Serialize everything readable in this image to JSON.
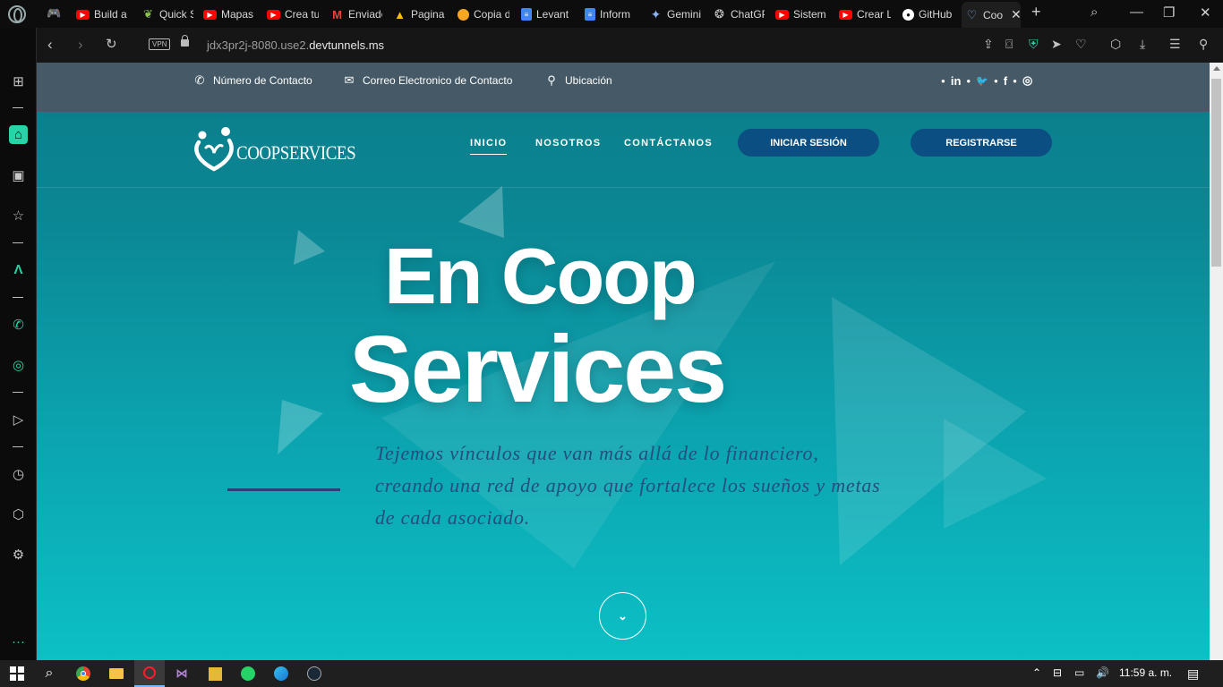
{
  "browser": {
    "tabs": [
      {
        "label": "Build a",
        "icon": "youtube-icon",
        "color": "#ff0000"
      },
      {
        "label": "Quick S",
        "icon": "leaf-icon",
        "color": "#8bc34a"
      },
      {
        "label": "Mapas",
        "icon": "youtube-icon",
        "color": "#ff0000"
      },
      {
        "label": "Crea tu",
        "icon": "youtube-icon",
        "color": "#ff0000"
      },
      {
        "label": "Enviado",
        "icon": "gmail-icon",
        "color": "#ea4335"
      },
      {
        "label": "Pagina",
        "icon": "drive-icon",
        "color": "#fbbc04"
      },
      {
        "label": "Copia d",
        "icon": "circle-icon",
        "color": "#f5a623"
      },
      {
        "label": "Levant",
        "icon": "docs-icon",
        "color": "#4285f4"
      },
      {
        "label": "Inform",
        "icon": "docs-icon",
        "color": "#4285f4"
      },
      {
        "label": "Gemini",
        "icon": "gemini-icon",
        "color": "#8ab4f8"
      },
      {
        "label": "ChatGP",
        "icon": "openai-icon",
        "color": "#cccccc"
      },
      {
        "label": "Sistem",
        "icon": "youtube-icon",
        "color": "#ff0000"
      },
      {
        "label": "Crear L",
        "icon": "youtube-icon",
        "color": "#ff0000"
      },
      {
        "label": "GitHub",
        "icon": "github-icon",
        "color": "#ffffff"
      },
      {
        "label": "Coo",
        "icon": "coop-icon",
        "color": "#7aa7e0"
      }
    ],
    "new_tab": "+",
    "url_prefix": "jdx3pr2j-8080.use2.",
    "url_domain": "devtunnels.ms",
    "vpn_label": "VPN"
  },
  "site": {
    "topbar": {
      "phone": "Número de Contacto",
      "email": "Correo Electronico de Contacto",
      "location": "Ubicación",
      "social": [
        "in",
        "🐦",
        "f",
        "◎"
      ]
    },
    "brand": "COOPSERVICES",
    "nav": {
      "home": "INICIO",
      "about": "NOSOTROS",
      "contact": "CONTÁCTANOS",
      "login": "INICIAR SESIÓN",
      "register": "REGISTRARSE"
    },
    "hero": {
      "line1": "En Coop",
      "line2": "Services",
      "subtitle": "Tejemos vínculos que van más allá de lo financiero, creando una red de apoyo que fortalece los sueños y metas de cada asociado."
    }
  },
  "taskbar": {
    "clock": "11:59 a. m."
  },
  "colors": {
    "accent": "#27d3a7",
    "hero_top": "#0b7d8a",
    "hero_bottom": "#0cc0c6",
    "button_bg": "#0b4f82",
    "topbar_bg": "#455a66"
  }
}
